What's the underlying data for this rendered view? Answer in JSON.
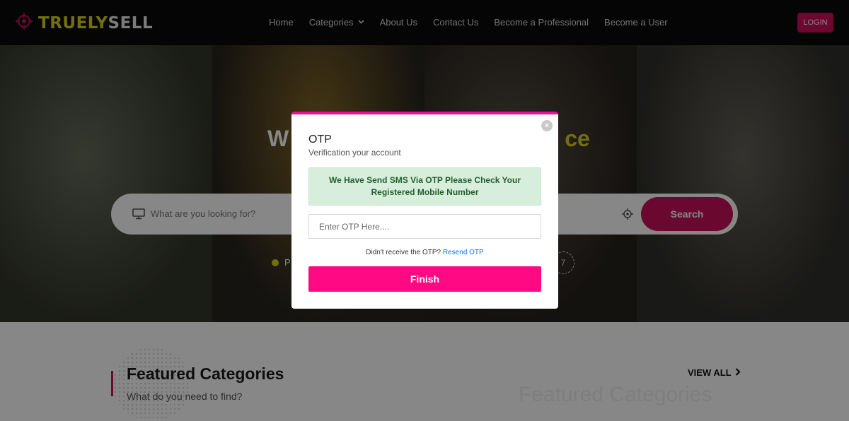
{
  "brand": {
    "part1": "TRUELY",
    "part2": "SELL"
  },
  "nav": {
    "items": [
      {
        "label": "Home"
      },
      {
        "label": "Categories",
        "has_dropdown": true
      },
      {
        "label": "About Us"
      },
      {
        "label": "Contact Us"
      },
      {
        "label": "Become a Professional"
      },
      {
        "label": "Become a User"
      }
    ],
    "login_label": "LOGIN"
  },
  "hero": {
    "title_visible_left": "W",
    "title_visible_right": "ce",
    "search_placeholder": "What are you looking for?",
    "search_button": "Search",
    "popular_visible": "P",
    "badge_visible": "7"
  },
  "featured": {
    "title": "Featured Categories",
    "subtitle": "What do you need to find?",
    "view_all": "VIEW ALL",
    "ghost_title": "Featured Categories"
  },
  "otp_modal": {
    "title": "OTP",
    "subtitle": "Verification your account",
    "alert": "We Have Send SMS Via OTP Please Check Your Registered Mobile Number",
    "input_placeholder": "Enter OTP Here....",
    "resend_prompt": "Didn't receive the OTP?",
    "resend_link": "Resend OTP",
    "finish_button": "Finish",
    "close_symbol": "×"
  },
  "colors": {
    "brand_pink": "#c8105a",
    "modal_accent": "#f2118d",
    "finish_button": "#ff0a84",
    "logo_yellow": "#d9d21c",
    "alert_bg": "#d7eedc",
    "alert_text": "#23602e",
    "link_blue": "#1a6fe0"
  },
  "icons": {
    "logo": "crosshair-target-icon",
    "search_field": "monitor-icon",
    "location": "crosshair-locate-icon",
    "view_all": "chevron-right-icon",
    "dropdown": "chevron-down-icon",
    "close": "close-icon"
  }
}
